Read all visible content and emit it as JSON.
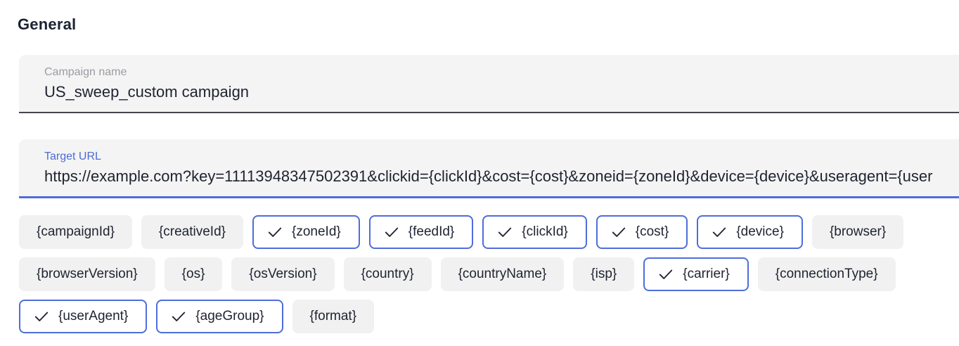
{
  "section": {
    "title": "General"
  },
  "campaign_name": {
    "label": "Campaign name",
    "value": "US_sweep_custom campaign"
  },
  "target_url": {
    "label": "Target URL",
    "value": "https://example.com?key=11113948347502391&clickid={clickId}&cost={cost}&zoneid={zoneId}&device={device}&useragent={user"
  },
  "tokens": [
    {
      "label": "{campaignId}",
      "selected": false
    },
    {
      "label": "{creativeId}",
      "selected": false
    },
    {
      "label": "{zoneId}",
      "selected": true
    },
    {
      "label": "{feedId}",
      "selected": true
    },
    {
      "label": "{clickId}",
      "selected": true
    },
    {
      "label": "{cost}",
      "selected": true
    },
    {
      "label": "{device}",
      "selected": true
    },
    {
      "label": "{browser}",
      "selected": false
    },
    {
      "label": "{browserVersion}",
      "selected": false
    },
    {
      "label": "{os}",
      "selected": false
    },
    {
      "label": "{osVersion}",
      "selected": false
    },
    {
      "label": "{country}",
      "selected": false
    },
    {
      "label": "{countryName}",
      "selected": false
    },
    {
      "label": "{isp}",
      "selected": false
    },
    {
      "label": "{carrier}",
      "selected": true
    },
    {
      "label": "{connectionType}",
      "selected": false
    },
    {
      "label": "{userAgent}",
      "selected": true
    },
    {
      "label": "{ageGroup}",
      "selected": true
    },
    {
      "label": "{format}",
      "selected": false
    }
  ],
  "colors": {
    "accent": "#4f6ddb",
    "chip_bg": "#f1f1f1",
    "field_bg": "#f4f4f4"
  },
  "icons": {
    "selected_token": "check-icon"
  }
}
